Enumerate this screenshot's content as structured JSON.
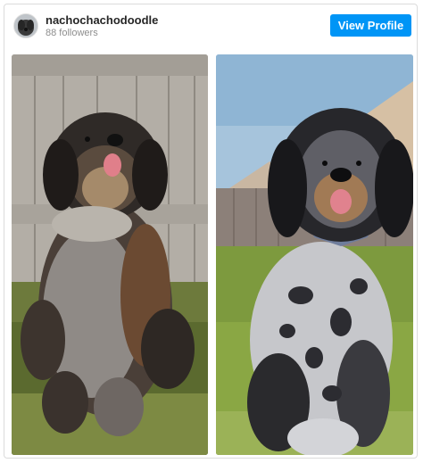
{
  "profile": {
    "username": "nachochachodoodle",
    "followers": "88 followers",
    "view_profile_label": "View Profile",
    "avatar_icon": "dog-avatar-icon"
  },
  "photos": [
    {
      "subject": "dog-photo-fence",
      "background": "wooden-fence-yard"
    },
    {
      "subject": "dog-photo-merle",
      "background": "yard-sunset"
    }
  ],
  "colors": {
    "button": "#0095f6",
    "username": "#262626",
    "muted": "#8e8e8e",
    "border": "#dbdbdb"
  }
}
